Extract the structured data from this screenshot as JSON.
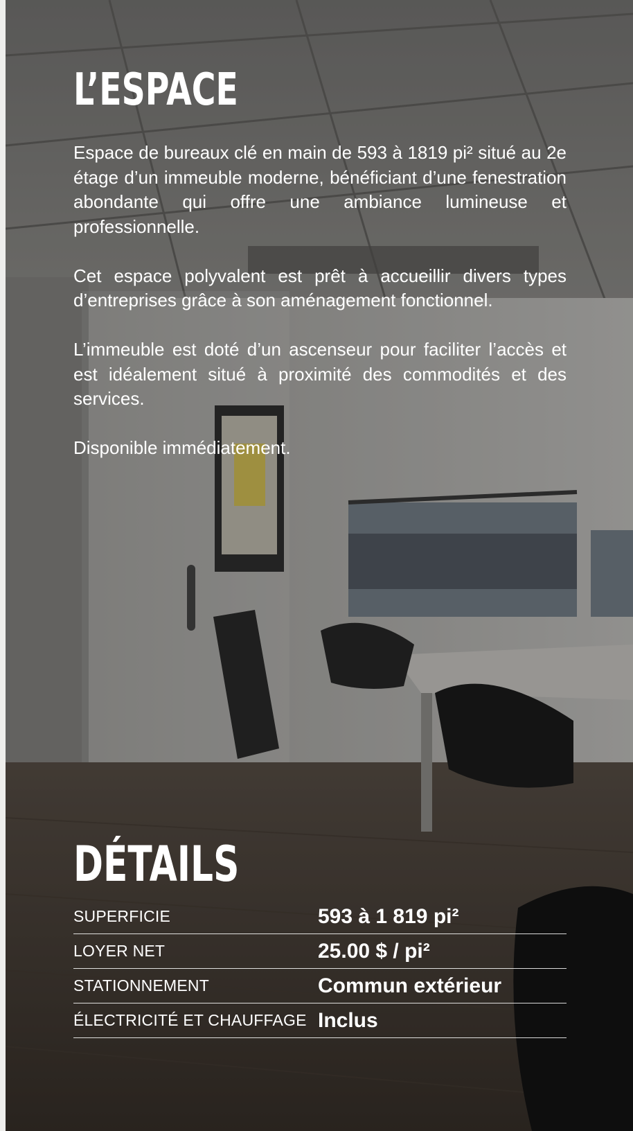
{
  "espace": {
    "title": "L’ESPACE",
    "paragraphs": [
      "Espace de bureaux clé en main de 593 à 1819 pi² situé au 2e étage d’un immeuble moderne, bénéficiant d’une fenestration abondante qui offre une ambiance lumineuse et professionnelle.",
      "Cet espace polyvalent est prêt à accueillir divers types d’entreprises grâce à son aménagement fonctionnel.",
      "L’immeuble est doté d’un ascenseur pour faciliter l’accès et est idéalement situé à proximité des commodités et des services.",
      "Disponible immédiatement."
    ]
  },
  "details": {
    "title": "DÉTAILS",
    "rows": [
      {
        "label": "SUPERFICIE",
        "value": "593 à 1 819 pi²"
      },
      {
        "label": "LOYER NET",
        "value": "25.00 $ / pi²"
      },
      {
        "label": "STATIONNEMENT",
        "value": "Commun extérieur"
      },
      {
        "label": "ÉLECTRICITÉ ET CHAUFFAGE",
        "value": "Inclus"
      }
    ]
  },
  "colors": {
    "text": "#ffffff",
    "overlay": "rgba(0,0,0,0.30)",
    "page_edge": "#eeeeec"
  },
  "background_image": "office-interior-photo"
}
